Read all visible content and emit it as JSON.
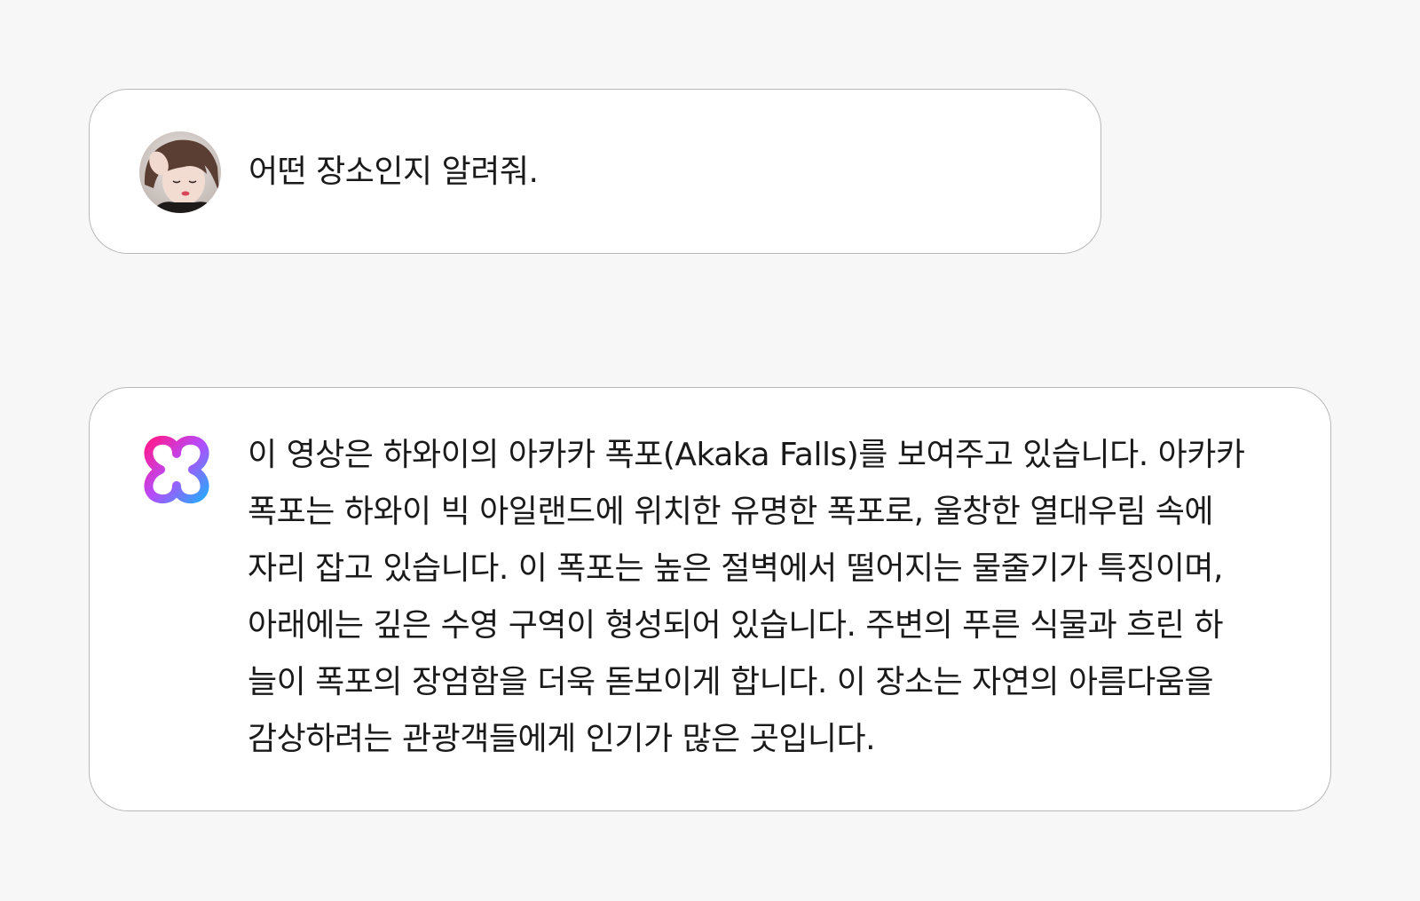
{
  "user_message": {
    "text": "어떤 장소인지 알려줘."
  },
  "assistant_message": {
    "lines": [
      "이 영상은 하와이의 아카카 폭포(Akaka Falls)를 보여주고 있습니다. 아카카",
      "폭포는 하와이 빅 아일랜드에 위치한 유명한 폭포로, 울창한 열대우림 속에",
      "자리 잡고 있습니다. 이 폭포는 높은 절벽에서 떨어지는 물줄기가 특징이며,",
      "아래에는 깊은 수영 구역이 형성되어 있습니다. 주변의 푸른 식물과 흐린 하",
      "늘이 폭포의 장엄함을 더욱 돋보이게 합니다. 이 장소는 자연의 아름다움을",
      "감상하려는 관광객들에게 인기가 많은 곳입니다."
    ]
  },
  "colors": {
    "background": "#f7f7f7",
    "bubble_background": "#ffffff",
    "bubble_border": "#b8b8b8",
    "text": "#1a1a1a",
    "logo_gradient": [
      "#ff1a8c",
      "#b44cff",
      "#2aa8ff"
    ]
  },
  "icons": {
    "user_avatar": "user-avatar-photo",
    "assistant_logo": "four-lobed-flower-logo"
  }
}
